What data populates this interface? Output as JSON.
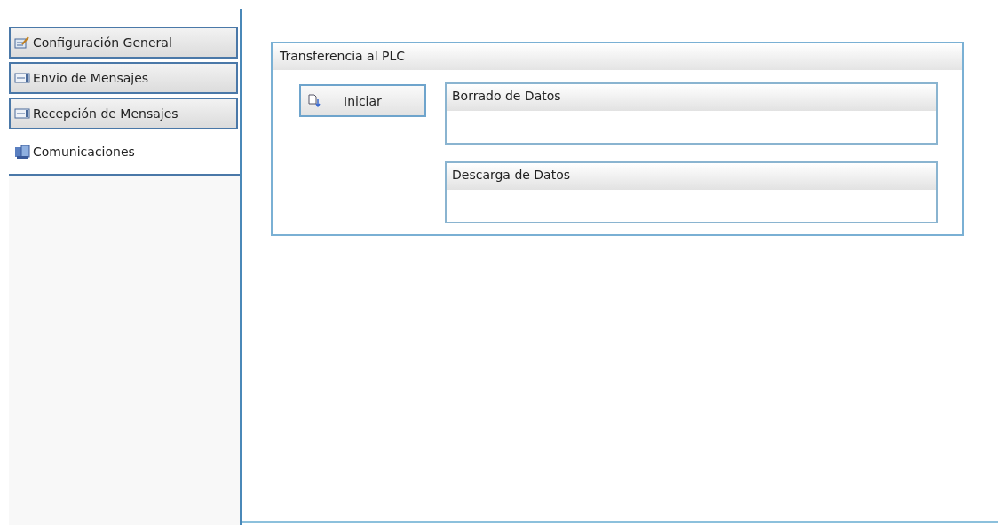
{
  "sidebar": {
    "items": [
      {
        "label": "Configuración General",
        "kind": "config",
        "selected": false
      },
      {
        "label": "Envio de Mensajes",
        "kind": "send",
        "selected": false
      },
      {
        "label": "Recepción de Mensajes",
        "kind": "receive",
        "selected": false
      },
      {
        "label": "Comunicaciones",
        "kind": "comm",
        "selected": true
      }
    ]
  },
  "group": {
    "title": "Transferencia al PLC",
    "button": "Iniciar",
    "sections": [
      {
        "title": "Borrado de Datos"
      },
      {
        "title": "Descarga de Datos"
      }
    ]
  }
}
